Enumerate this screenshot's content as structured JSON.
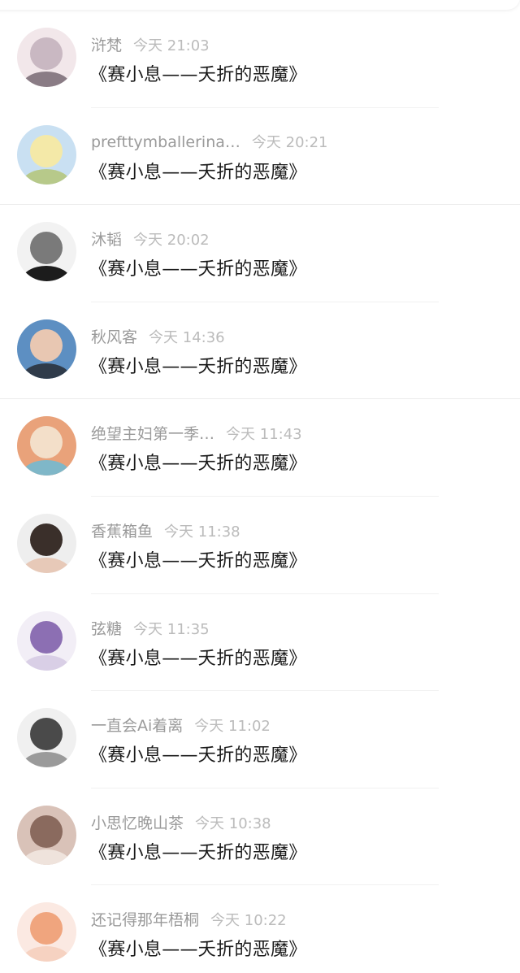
{
  "comments": [
    {
      "name": "浒梵",
      "time": "今天 21:03",
      "title": "《赛小息——夭折的恶魔》",
      "avatar_colors": [
        "#f2e7ea",
        "#c9b8c2",
        "#8a7c85"
      ]
    },
    {
      "name": "prefttymballerina…",
      "time": "今天 20:21",
      "title": "《赛小息——夭折的恶魔》",
      "avatar_colors": [
        "#c9e0f2",
        "#f4e9a8",
        "#b7c98a"
      ]
    },
    {
      "name": "沐韬",
      "time": "今天 20:02",
      "title": "《赛小息——夭折的恶魔》",
      "avatar_colors": [
        "#f2f2f2",
        "#7a7a7a",
        "#1c1c1c"
      ]
    },
    {
      "name": "秋风客",
      "time": "今天 14:36",
      "title": "《赛小息——夭折的恶魔》",
      "avatar_colors": [
        "#5d8fc2",
        "#e8c7b2",
        "#2f3b4a"
      ]
    },
    {
      "name": "绝望主妇第一季…",
      "time": "今天 11:43",
      "title": "《赛小息——夭折的恶魔》",
      "avatar_colors": [
        "#e9a27a",
        "#f3dfc9",
        "#7fb7c8"
      ]
    },
    {
      "name": "香蕉箱鱼",
      "time": "今天 11:38",
      "title": "《赛小息——夭折的恶魔》",
      "avatar_colors": [
        "#eeeeee",
        "#3a2f2a",
        "#e7c9b8"
      ]
    },
    {
      "name": "弦糖",
      "time": "今天 11:35",
      "title": "《赛小息——夭折的恶魔》",
      "avatar_colors": [
        "#f2eef6",
        "#8c6fb3",
        "#d9cfe6"
      ]
    },
    {
      "name": "一直会Ai着离",
      "time": "今天 11:02",
      "title": "《赛小息——夭折的恶魔》",
      "avatar_colors": [
        "#f0f0f0",
        "#4a4a4a",
        "#9a9a9a"
      ]
    },
    {
      "name": "小思忆晚山茶",
      "time": "今天 10:38",
      "title": "《赛小息——夭折的恶魔》",
      "avatar_colors": [
        "#d9c2b8",
        "#8a6a5e",
        "#efe3dc"
      ]
    },
    {
      "name": "还记得那年梧桐",
      "time": "今天 10:22",
      "title": "《赛小息——夭折的恶魔》",
      "avatar_colors": [
        "#fbe9e2",
        "#f0a57e",
        "#f6d2c1"
      ]
    }
  ]
}
